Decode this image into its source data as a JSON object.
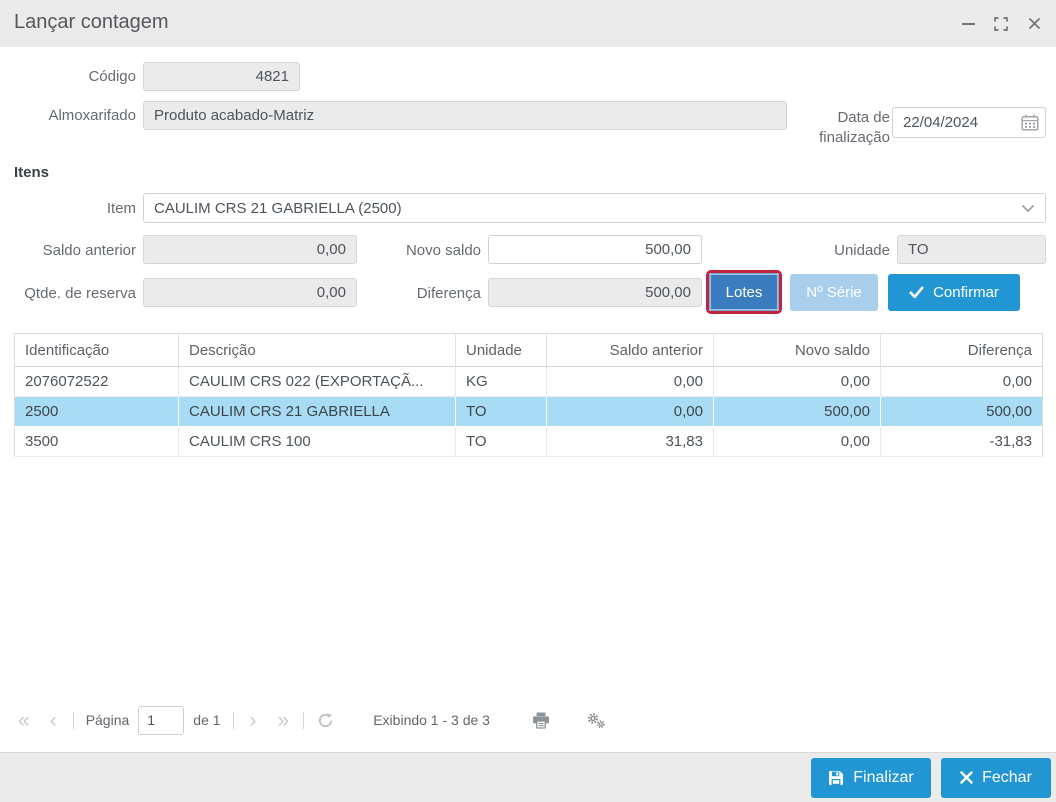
{
  "window": {
    "title": "Lançar contagem"
  },
  "form": {
    "codigo_label": "Código",
    "codigo_value": "4821",
    "almoxarifado_label": "Almoxarifado",
    "almoxarifado_value": "Produto acabado-Matriz",
    "data_finalizacao_label": "Data de finalização",
    "data_finalizacao_value": "22/04/2024",
    "itens_heading": "Itens",
    "item_label": "Item",
    "item_value": "CAULIM CRS 21 GABRIELLA (2500)",
    "saldo_anterior_label": "Saldo anterior",
    "saldo_anterior_value": "0,00",
    "novo_saldo_label": "Novo saldo",
    "novo_saldo_value": "500,00",
    "unidade_label": "Unidade",
    "unidade_value": "TO",
    "qtde_reserva_label": "Qtde. de reserva",
    "qtde_reserva_value": "0,00",
    "diferenca_label": "Diferença",
    "diferenca_value": "500,00",
    "lotes_button": "Lotes",
    "nserie_button": "Nº Série",
    "confirmar_button": "Confirmar"
  },
  "table": {
    "columns": [
      "Identificação",
      "Descrição",
      "Unidade",
      "Saldo anterior",
      "Novo saldo",
      "Diferença"
    ],
    "rows": [
      {
        "identificacao": "2076072522",
        "descricao": "CAULIM CRS 022 (EXPORTAÇÃ...",
        "unidade": "KG",
        "saldo_anterior": "0,00",
        "novo_saldo": "0,00",
        "diferenca": "0,00",
        "selected": false
      },
      {
        "identificacao": "2500",
        "descricao": "CAULIM CRS 21 GABRIELLA",
        "unidade": "TO",
        "saldo_anterior": "0,00",
        "novo_saldo": "500,00",
        "diferenca": "500,00",
        "selected": true
      },
      {
        "identificacao": "3500",
        "descricao": "CAULIM CRS 100",
        "unidade": "TO",
        "saldo_anterior": "31,83",
        "novo_saldo": "0,00",
        "diferenca": "-31,83",
        "selected": false
      }
    ]
  },
  "pagination": {
    "first_icon": "«",
    "prev_icon": "‹",
    "page_label": "Página",
    "page_value": "1",
    "of_label": "de 1",
    "next_icon": "›",
    "last_icon": "»",
    "status": "Exibindo 1 - 3 de 3"
  },
  "footer": {
    "finalizar_button": "Finalizar",
    "fechar_button": "Fechar"
  },
  "icons": {
    "titlebar": [
      "minimize-icon",
      "maximize-icon",
      "close-icon"
    ],
    "calendar": "calendar-icon",
    "combo_chevron": "chevron-down-icon",
    "confirm_check": "check-icon",
    "refresh": "refresh-icon",
    "printer": "printer-icon",
    "settings": "settings-gears-icon",
    "save": "save-floppy-icon",
    "close_x": "close-x-icon"
  },
  "colors": {
    "accent_blue": "#2196d3",
    "pressed_blue": "#3a7cbd",
    "disabled_blue": "#a9cfec",
    "selection_blue": "#a7dcf4",
    "annotation_red": "#c2243c",
    "titlebar_gray": "#ebebeb",
    "disabled_field_bg": "#ebebeb"
  }
}
